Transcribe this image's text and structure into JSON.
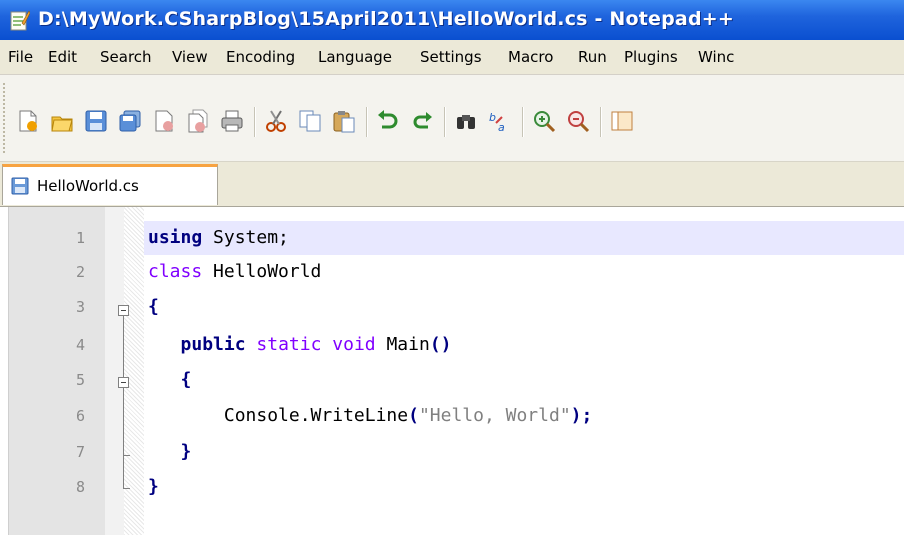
{
  "window": {
    "title": "D:\\MyWork.CSharpBlog\\15April2011\\HelloWorld.cs - Notepad++",
    "icon": "notepad-icon"
  },
  "menu": {
    "items": [
      "File",
      "Edit",
      "Search",
      "View",
      "Encoding",
      "Language",
      "Settings",
      "Macro",
      "Run",
      "Plugins",
      "Winc"
    ]
  },
  "toolbar": {
    "buttons": [
      "new-file-icon",
      "open-file-icon",
      "save-icon",
      "save-all-icon",
      "close-icon",
      "close-all-icon",
      "print-icon",
      "cut-icon",
      "copy-icon",
      "paste-icon",
      "undo-icon",
      "redo-icon",
      "find-icon",
      "replace-icon",
      "zoom-in-icon",
      "zoom-out-icon",
      "sync-scroll-icon"
    ]
  },
  "tabs": [
    {
      "label": "HelloWorld.cs",
      "icon": "saved-file-icon",
      "active": true
    }
  ],
  "editor": {
    "line_numbers": [
      "1",
      "2",
      "3",
      "4",
      "5",
      "6",
      "7",
      "8"
    ],
    "current_line": 1,
    "lines": [
      {
        "tokens": [
          {
            "t": "using",
            "c": "kw"
          },
          {
            "t": " System;",
            "c": "plain"
          }
        ]
      },
      {
        "tokens": [
          {
            "t": "class",
            "c": "type"
          },
          {
            "t": " HelloWorld",
            "c": "plain"
          }
        ]
      },
      {
        "tokens": [
          {
            "t": "{",
            "c": "br"
          }
        ]
      },
      {
        "tokens": [
          {
            "t": "   ",
            "c": "plain"
          },
          {
            "t": "public",
            "c": "kw"
          },
          {
            "t": " ",
            "c": "plain"
          },
          {
            "t": "static",
            "c": "type"
          },
          {
            "t": " ",
            "c": "plain"
          },
          {
            "t": "void",
            "c": "type"
          },
          {
            "t": " Main",
            "c": "plain"
          },
          {
            "t": "()",
            "c": "br"
          }
        ]
      },
      {
        "tokens": [
          {
            "t": "   ",
            "c": "plain"
          },
          {
            "t": "{",
            "c": "br"
          }
        ]
      },
      {
        "tokens": [
          {
            "t": "       Console.WriteLine",
            "c": "plain"
          },
          {
            "t": "(",
            "c": "br"
          },
          {
            "t": "\"Hello, World\"",
            "c": "str"
          },
          {
            "t": ");",
            "c": "br"
          }
        ]
      },
      {
        "tokens": [
          {
            "t": "   ",
            "c": "plain"
          },
          {
            "t": "}",
            "c": "br"
          }
        ]
      },
      {
        "tokens": [
          {
            "t": "}",
            "c": "br"
          }
        ]
      }
    ]
  },
  "colors": {
    "titlebar": "#0a4fd0",
    "keyword": "#00007f",
    "type_keyword": "#8000ff",
    "string": "#808080",
    "active_tab_accent": "#f7a341"
  }
}
